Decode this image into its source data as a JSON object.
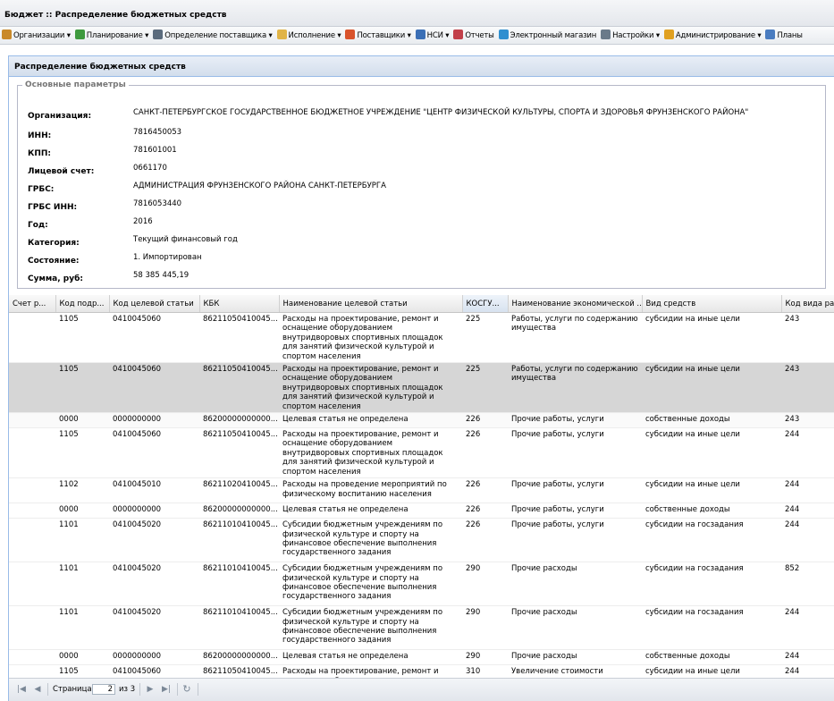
{
  "window": {
    "title": "Бюджет :: Распределение бюджетных средств"
  },
  "menu": [
    {
      "label": "Организации",
      "icon": "organizations-icon",
      "arrow": true,
      "color": "#c9892a"
    },
    {
      "label": "Планирование",
      "icon": "planning-icon",
      "arrow": true,
      "color": "#3e9a3e"
    },
    {
      "label": "Определение поставщика",
      "icon": "gear-icon",
      "arrow": true,
      "color": "#5b6b7d"
    },
    {
      "label": "Исполнение",
      "icon": "folder-icon",
      "arrow": true,
      "color": "#e1b447"
    },
    {
      "label": "Поставщики",
      "icon": "supplier-icon",
      "arrow": true,
      "color": "#d9532c"
    },
    {
      "label": "НСИ",
      "icon": "catalog-icon",
      "arrow": true,
      "color": "#3b6fb6"
    },
    {
      "label": "Отчеты",
      "icon": "report-icon",
      "arrow": false,
      "color": "#c2404a"
    },
    {
      "label": "Электронный магазин",
      "icon": "shop-icon",
      "arrow": false,
      "color": "#2f8fd0"
    },
    {
      "label": "Настройки",
      "icon": "wrench-icon",
      "arrow": true,
      "color": "#6a7a8a"
    },
    {
      "label": "Администрирование",
      "icon": "admin-user-icon",
      "arrow": true,
      "color": "#e0a020"
    },
    {
      "label": "Планы",
      "icon": "plans-user-icon",
      "arrow": false,
      "color": "#4a7cc0"
    }
  ],
  "panel": {
    "title": "Распределение бюджетных средств"
  },
  "params": {
    "legend": "Основные параметры",
    "fields": [
      {
        "label": "Организация:",
        "value": "САНКТ-ПЕТЕРБУРГСКОЕ ГОСУДАРСТВЕННОЕ БЮДЖЕТНОЕ УЧРЕЖДЕНИЕ \"ЦЕНТР ФИЗИЧЕСКОЙ КУЛЬТУРЫ, СПОРТА И ЗДОРОВЬЯ ФРУНЗЕНСКОГО РАЙОНА\""
      },
      {
        "label": "ИНН:",
        "value": "7816450053"
      },
      {
        "label": "КПП:",
        "value": "781601001"
      },
      {
        "label": "Лицевой счет:",
        "value": "0661170"
      },
      {
        "label": "ГРБС:",
        "value": "АДМИНИСТРАЦИЯ ФРУНЗЕНСКОГО РАЙОНА САНКТ-ПЕТЕРБУРГА"
      },
      {
        "label": "ГРБС ИНН:",
        "value": "7816053440"
      },
      {
        "label": "Год:",
        "value": "2016"
      },
      {
        "label": "Категория:",
        "value": "Текущий финансовый год"
      },
      {
        "label": "Состояние:",
        "value": "1. Импортирован"
      },
      {
        "label": "Сумма, руб:",
        "value": "58 385 445,19"
      }
    ]
  },
  "grid": {
    "columns": [
      "Счет р...",
      "Код подр...",
      "Код целевой статьи",
      "КБК",
      "Наименование целевой статьи",
      "КОСГУ...",
      "Наименование экономической ...",
      "Вид средств",
      "Код вида расх"
    ],
    "rows": [
      [
        "",
        "1105",
        "0410045060",
        "86211050410045...",
        "Расходы на проектирование, ремонт и оснащение оборудованием внутридворовых спортивных площадок для занятий физической культурой и спортом населения",
        "225",
        "Работы, услуги по содержанию имущества",
        "субсидии на иные цели",
        "243"
      ],
      [
        "",
        "1105",
        "0410045060",
        "86211050410045...",
        "Расходы на проектирование, ремонт и оснащение оборудованием внутридворовых спортивных площадок для занятий физической культурой и спортом населения",
        "225",
        "Работы, услуги по содержанию имущества",
        "субсидии на иные цели",
        "243"
      ],
      [
        "",
        "0000",
        "0000000000",
        "86200000000000...",
        "Целевая статья не определена",
        "226",
        "Прочие работы, услуги",
        "собственные доходы",
        "243"
      ],
      [
        "",
        "1105",
        "0410045060",
        "86211050410045...",
        "Расходы на проектирование, ремонт и оснащение оборудованием внутридворовых спортивных площадок для занятий физической культурой и спортом населения",
        "226",
        "Прочие работы, услуги",
        "субсидии на иные цели",
        "244"
      ],
      [
        "",
        "1102",
        "0410045010",
        "86211020410045...",
        "Расходы на проведение мероприятий по физическому воспитанию населения",
        "226",
        "Прочие работы, услуги",
        "субсидии на иные цели",
        "244"
      ],
      [
        "",
        "0000",
        "0000000000",
        "86200000000000...",
        "Целевая статья не определена",
        "226",
        "Прочие работы, услуги",
        "собственные доходы",
        "244"
      ],
      [
        "",
        "1101",
        "0410045020",
        "86211010410045...",
        "Субсидии бюджетным учреждениям по физической культуре и спорту на финансовое обеспечение выполнения государственного задания",
        "226",
        "Прочие работы, услуги",
        "субсидии на госзадания",
        "244"
      ],
      [
        "",
        "1101",
        "0410045020",
        "86211010410045...",
        "Субсидии бюджетным учреждениям по физической культуре и спорту на финансовое обеспечение выполнения государственного задания",
        "290",
        "Прочие расходы",
        "субсидии на госзадания",
        "852"
      ],
      [
        "",
        "1101",
        "0410045020",
        "86211010410045...",
        "Субсидии бюджетным учреждениям по физической культуре и спорту на финансовое обеспечение выполнения государственного задания",
        "290",
        "Прочие расходы",
        "субсидии на госзадания",
        "244"
      ],
      [
        "",
        "0000",
        "0000000000",
        "86200000000000...",
        "Целевая статья не определена",
        "290",
        "Прочие расходы",
        "собственные доходы",
        "244"
      ],
      [
        "",
        "1105",
        "0410045060",
        "86211050410045...",
        "Расходы на проектирование, ремонт и оснащение оборудованием внутридворовых спортивных площадок для занятий физической культурой и спортом населения",
        "310",
        "Увеличение стоимости основных средств",
        "субсидии на иные цели",
        "244"
      ]
    ]
  },
  "pager": {
    "page_label": "Страница",
    "page_value": "2",
    "of_label": "из 3"
  }
}
